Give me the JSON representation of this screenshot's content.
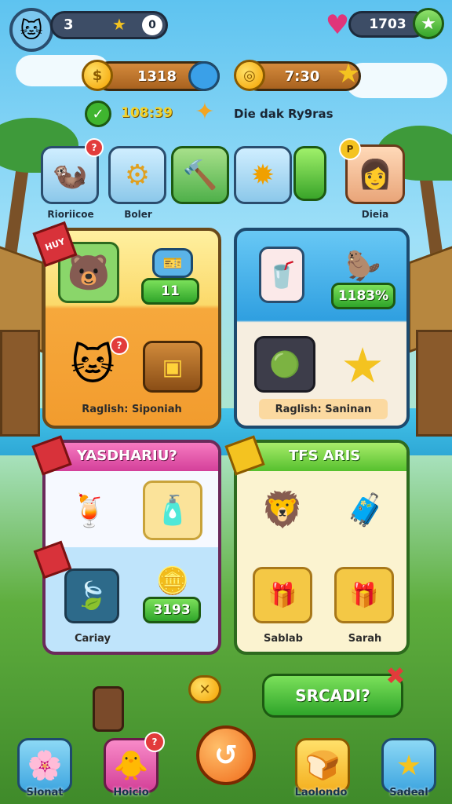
{
  "top_bar": {
    "avatar_icon": "cat-face-icon",
    "level": "3",
    "counter_right": "1703",
    "heart_icon": "heart-icon",
    "star_icon": "star-icon"
  },
  "currencies": {
    "gold": "1318",
    "silver": "7:30",
    "green_value": "108:39",
    "promo_text": "Die dak Ry9ras"
  },
  "icon_row": [
    {
      "name": "otter",
      "label": "Rioriicoe",
      "badge": "?"
    },
    {
      "name": "gear",
      "label": "Boler",
      "badge": ""
    },
    {
      "name": "hammer",
      "label": "",
      "badge": ""
    },
    {
      "name": "sun",
      "label": "",
      "badge": ""
    },
    {
      "name": "gem",
      "label": "",
      "badge": ""
    },
    {
      "name": "girl-avatar",
      "label": "Dieia",
      "badge": "P"
    }
  ],
  "panel_a": {
    "ribbon": "HUY",
    "pet_badge": "?",
    "button": "11",
    "footer": "Raglish: Siponiah"
  },
  "panel_b": {
    "button": "1183%",
    "footer": "Raglish: Saninan"
  },
  "panel_c": {
    "title": "YASDHARIU?",
    "button": "3193",
    "caption": "Cariay"
  },
  "panel_d": {
    "title": "TFS ARIS",
    "caption_left": "Sablab",
    "caption_right": "Sarah"
  },
  "action_button": "SRCADI?",
  "bottom_nav": [
    {
      "icon": "flower-icon",
      "label": "Slonat"
    },
    {
      "icon": "chick-icon",
      "label": "Hoicio",
      "badge": "?"
    },
    {
      "icon": "coin-action-icon",
      "label": ""
    },
    {
      "icon": "toast-icon",
      "label": "Laolondo"
    },
    {
      "icon": "star-icon",
      "label": "Sadeal"
    }
  ],
  "colors": {
    "accent_orange": "#f39b2a",
    "accent_green": "#3fb52f",
    "accent_blue": "#2f9fe0",
    "accent_pink": "#e05aa8"
  }
}
